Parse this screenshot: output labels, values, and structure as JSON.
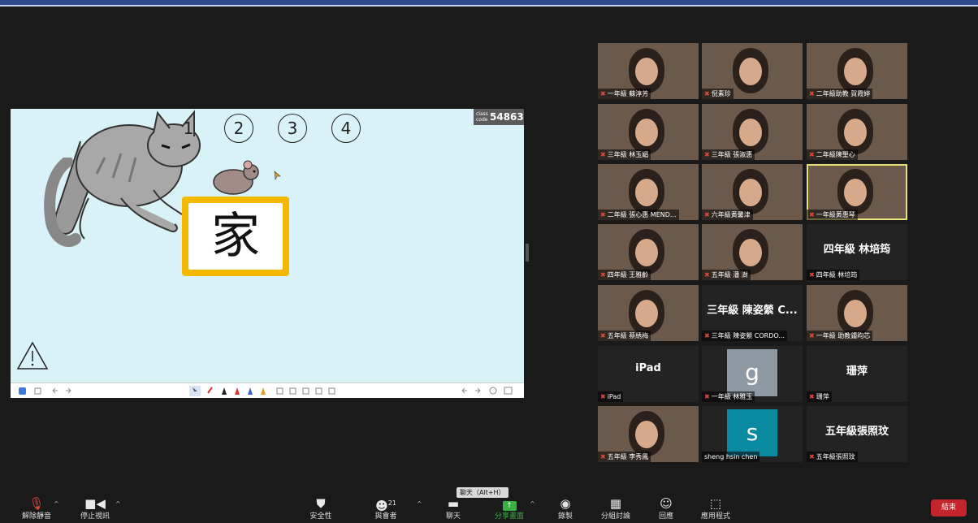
{
  "share": {
    "class_code_label": "class code",
    "class_code": "54863",
    "numbers": [
      "2",
      "3",
      "4"
    ],
    "number_one_partial": "1",
    "character": "家"
  },
  "participants": [
    {
      "label": "一年級 蘇淳芳",
      "type": "video"
    },
    {
      "label": "倪素珍",
      "type": "video"
    },
    {
      "label": "二年級助教 賀霞婷",
      "type": "video"
    },
    {
      "label": "三年級 林玉媚",
      "type": "video"
    },
    {
      "label": "三年級 張淑惠",
      "type": "video"
    },
    {
      "label": "二年級陳聖心",
      "type": "video"
    },
    {
      "label": "二年級 張心惠 MEND...",
      "type": "video"
    },
    {
      "label": "六年級黃馨津",
      "type": "video"
    },
    {
      "label": "一年級黃惠琴",
      "type": "video",
      "active": true
    },
    {
      "label": "四年級 王雅齡",
      "type": "video"
    },
    {
      "label": "五年級 潘 澍",
      "type": "video"
    },
    {
      "label": "四年級 林培筠",
      "type": "name",
      "bigname": "四年級 林培筠"
    },
    {
      "label": "五年級 蔡綉梅",
      "type": "photo"
    },
    {
      "label": "三年級 陳姿縈 CORDO...",
      "type": "name",
      "bigname": "三年級 陳姿縈 C..."
    },
    {
      "label": "一年級 助教鍾昀芯",
      "type": "photo"
    },
    {
      "label": "iPad",
      "type": "name",
      "bigname": "iPad"
    },
    {
      "label": "一年級 林雅玉",
      "type": "initial",
      "initial": "g",
      "initial_color": "#8d9aa3"
    },
    {
      "label": "珊萍",
      "type": "name",
      "bigname": "珊萍"
    },
    {
      "label": "五年級 李秀鳳",
      "type": "photo"
    },
    {
      "label": "sheng hsin chen",
      "type": "initial",
      "initial": "s",
      "initial_color": "#0a8aa0",
      "unmuted": true
    },
    {
      "label": "五年級張照玟",
      "type": "name",
      "bigname": "五年級張照玟"
    }
  ],
  "toolbar": {
    "unmute": "解除靜音",
    "stop_video": "停止視訊",
    "security": "安全性",
    "participants": "與會者",
    "participant_count": "21",
    "chat": "聊天",
    "share_screen": "分享畫面",
    "record": "錄製",
    "breakout": "分組討論",
    "reactions": "回應",
    "apps": "應用程式",
    "end": "結束",
    "chat_tooltip": "聊天（Alt+H）"
  }
}
